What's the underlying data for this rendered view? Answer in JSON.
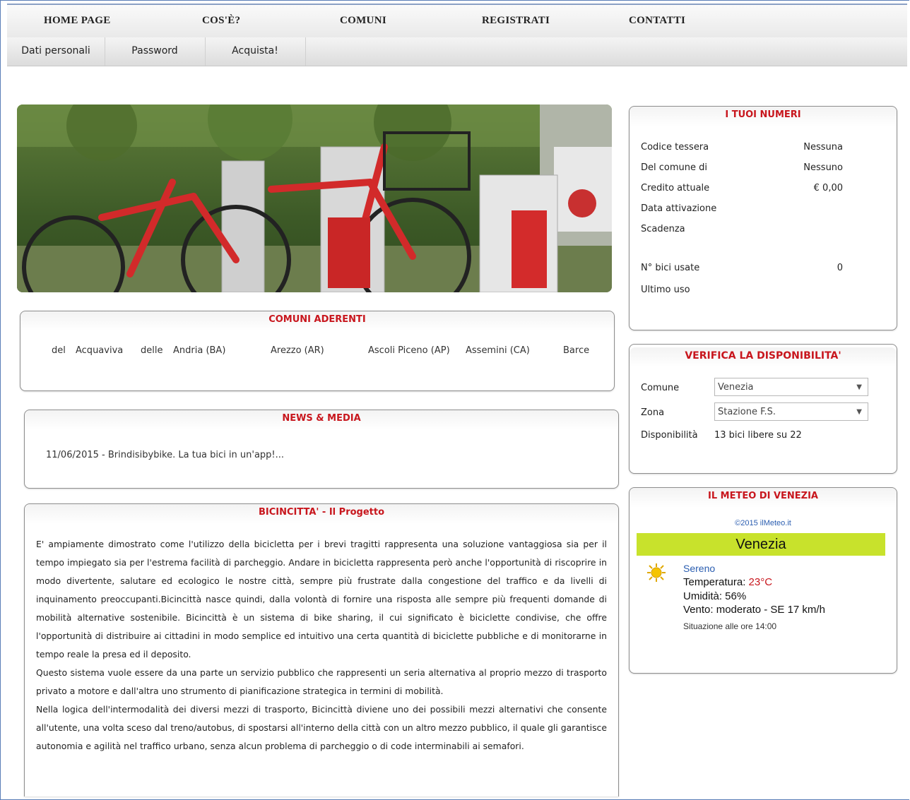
{
  "topnav": {
    "items": [
      "HOME PAGE",
      "COS'È?",
      "COMUNI",
      "REGISTRATI",
      "CONTATTI"
    ]
  },
  "subnav": {
    "items": [
      "Dati personali",
      "Password",
      "Acquista!"
    ]
  },
  "comuni": {
    "title": "COMUNI ADERENTI",
    "items": [
      "del",
      "Acquaviva",
      "delle",
      "Andria (BA)",
      "Arezzo (AR)",
      "Ascoli Piceno (AP)",
      "Assemini (CA)",
      "Barce"
    ]
  },
  "news": {
    "title": "NEWS & MEDIA",
    "line": "11/06/2015 - Brindisibybike. La tua bici in un'app!..."
  },
  "progetto": {
    "title": "BICINCITTA' - Il Progetto",
    "p1": "E' ampiamente dimostrato come l'utilizzo della bicicletta per i brevi tragitti rappresenta una soluzione vantaggiosa sia per il tempo impiegato sia per l'estrema facilità di parcheggio. Andare in bicicletta rappresenta però anche l'opportunità di riscoprire in modo divertente, salutare ed ecologico le nostre città, sempre più frustrate dalla congestione del traffico e da livelli di inquinamento preoccupanti.Bicincittà nasce quindi, dalla volontà di fornire una risposta alle sempre più frequenti domande di mobilità alternative sostenibile. Bicincittà è un sistema di bike sharing, il cui significato è biciclette condivise, che offre l'opportunità di distribuire ai cittadini in modo semplice ed intuitivo una certa quantità di biciclette pubbliche e di monitorarne in tempo reale la presa ed il deposito.",
    "p2": "Questo sistema vuole essere da una parte un servizio pubblico che rappresenti un seria alternativa al proprio mezzo di trasporto privato a motore e dall'altra uno strumento di pianificazione strategica in termini di mobilità.",
    "p3": "Nella logica dell'intermodalità dei diversi mezzi di trasporto, Bicincittà diviene uno dei possibili mezzi alternativi che consente all'utente, una volta sceso dal treno/autobus, di spostarsi all'interno della città con un altro mezzo pubblico, il quale gli garantisce autonomia e agilità nel traffico urbano, senza alcun problema di parcheggio o di code interminabili ai semafori."
  },
  "numeri": {
    "title": "I TUOI NUMERI",
    "rows": [
      {
        "label": "Codice tessera",
        "value": "Nessuna"
      },
      {
        "label": "Del comune di",
        "value": "Nessuno"
      },
      {
        "label": "Credito attuale",
        "value": "€ 0,00"
      },
      {
        "label": "Data attivazione",
        "value": ""
      },
      {
        "label": "Scadenza",
        "value": ""
      },
      {
        "label": "N° bici usate",
        "value": "0"
      },
      {
        "label": "Ultimo uso",
        "value": ""
      }
    ]
  },
  "verifica": {
    "title": "VERIFICA LA DISPONIBILITA'",
    "comune_label": "Comune",
    "comune_value": "Venezia",
    "zona_label": "Zona",
    "zona_value": "Stazione F.S.",
    "disp_label": "Disponibilità",
    "disp_value": "13 bici libere su 22"
  },
  "meteo": {
    "title": "IL METEO DI VENEZIA",
    "credit": "©2015 ilMeteo.it",
    "city": "Venezia",
    "condition": "Sereno",
    "temp_label": "Temperatura: ",
    "temp_value": "23°C",
    "umidita": "Umidità: 56%",
    "vento": "Vento: moderato - SE 17 km/h",
    "situazione": "Situazione alle ore 14:00",
    "icon": "sun-icon"
  },
  "colors": {
    "accent": "#c8161d",
    "meteo_bar": "#c8e22c",
    "link": "#2a5db0"
  }
}
